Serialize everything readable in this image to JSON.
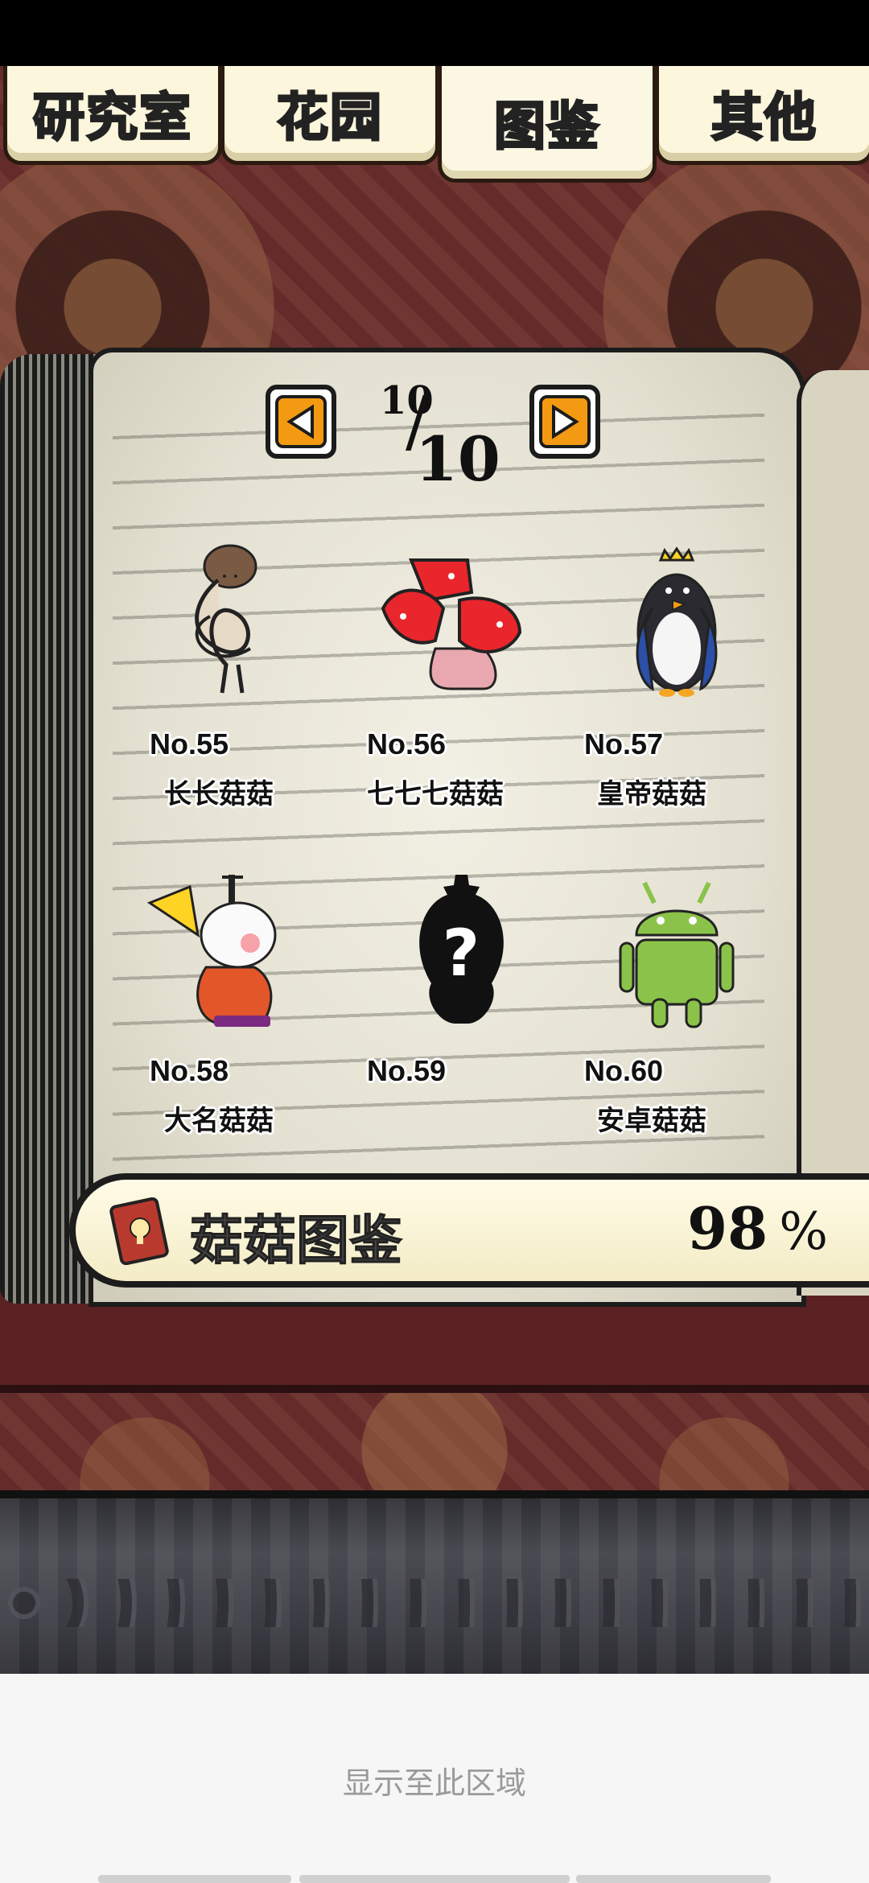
{
  "tabs": [
    {
      "label": "研究室",
      "active": false
    },
    {
      "label": "花园",
      "active": false
    },
    {
      "label": "图鉴",
      "active": true
    },
    {
      "label": "其他",
      "active": false
    }
  ],
  "pager": {
    "current": "10",
    "total": "10"
  },
  "entries": [
    {
      "no": "No.55",
      "name": "长长菇菇",
      "icon": "long-mushroom-icon"
    },
    {
      "no": "No.56",
      "name": "七七七菇菇",
      "icon": "red-triple-mushroom-icon"
    },
    {
      "no": "No.57",
      "name": "皇帝菇菇",
      "icon": "emperor-penguin-mushroom-icon"
    },
    {
      "no": "No.58",
      "name": "大名菇菇",
      "icon": "daimyo-mushroom-icon"
    },
    {
      "no": "No.59",
      "name": "",
      "icon": "unknown-silhouette-icon"
    },
    {
      "no": "No.60",
      "name": "安卓菇菇",
      "icon": "android-mushroom-icon"
    }
  ],
  "progress": {
    "title": "菇菇图鉴",
    "value": "98",
    "unit": "%"
  },
  "ad_notice": "显示至此区域",
  "colors": {
    "tab_active_text": "#ffe227",
    "nav_button": "#f39a12",
    "background": "#6b2f2c"
  }
}
